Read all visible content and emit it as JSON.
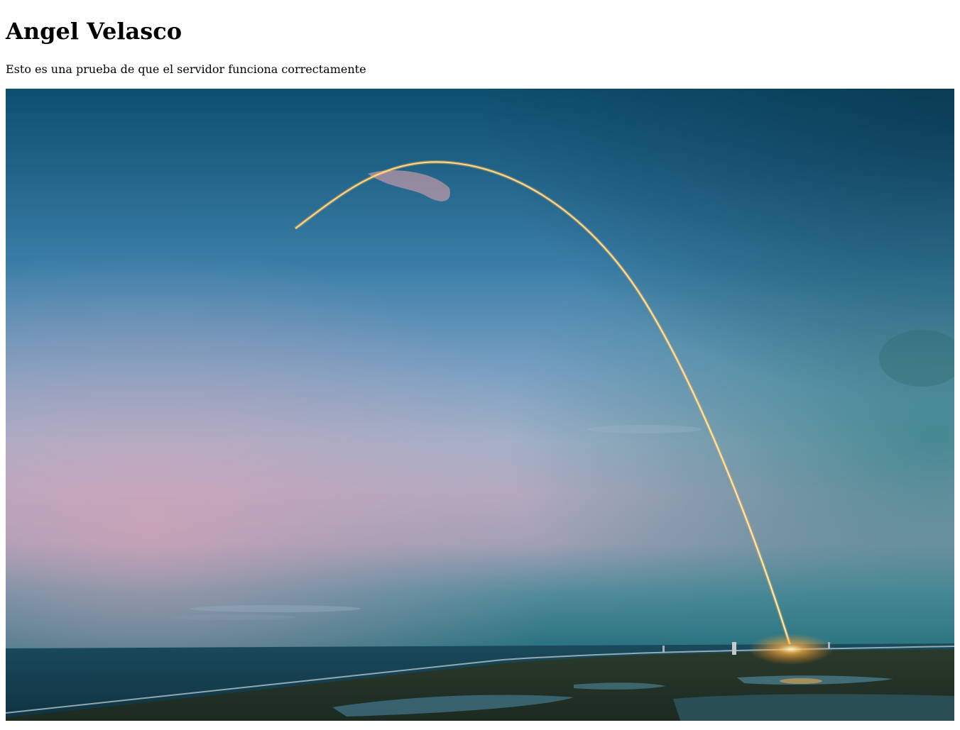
{
  "page": {
    "heading": "Angel Velasco",
    "paragraph": "Esto es una prueba de que el servidor funciona correctamente"
  },
  "image": {
    "subject": "rocket-launch-arc-over-coastline"
  }
}
